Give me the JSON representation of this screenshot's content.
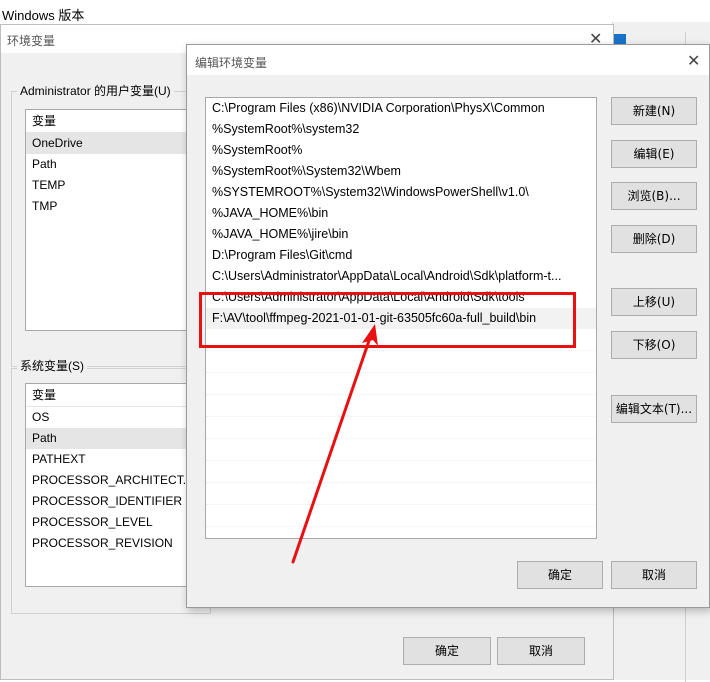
{
  "background_window": {
    "title": "Windows 版本"
  },
  "env_dialog": {
    "title": "环境变量",
    "user_vars": {
      "label": "Administrator 的用户变量(U)",
      "header": "变量",
      "items": [
        "OneDrive",
        "Path",
        "TEMP",
        "TMP"
      ],
      "selected_index": 0
    },
    "system_vars": {
      "label": "系统变量(S)",
      "header": "变量",
      "items": [
        "OS",
        "Path",
        "PATHEXT",
        "PROCESSOR_ARCHITECT...",
        "PROCESSOR_IDENTIFIER",
        "PROCESSOR_LEVEL",
        "PROCESSOR_REVISION"
      ],
      "selected_index": 1
    },
    "ok_label": "确定",
    "cancel_label": "取消"
  },
  "edit_dialog": {
    "title": "编辑环境变量",
    "paths": [
      "C:\\Program Files (x86)\\NVIDIA Corporation\\PhysX\\Common",
      "%SystemRoot%\\system32",
      "%SystemRoot%",
      "%SystemRoot%\\System32\\Wbem",
      "%SYSTEMROOT%\\System32\\WindowsPowerShell\\v1.0\\",
      "%JAVA_HOME%\\bin",
      "%JAVA_HOME%\\jire\\bin",
      "D:\\Program Files\\Git\\cmd",
      "C:\\Users\\Administrator\\AppData\\Local\\Android\\Sdk\\platform-t...",
      "C:\\Users\\Administrator\\AppData\\Local\\Android\\Sdk\\tools",
      "F:\\AV\\tool\\ffmpeg-2021-01-01-git-63505fc60a-full_build\\bin"
    ],
    "selected_index": 10,
    "buttons": {
      "new": "新建(N)",
      "edit": "编辑(E)",
      "browse": "浏览(B)...",
      "delete": "删除(D)",
      "move_up": "上移(U)",
      "move_down": "下移(O)",
      "edit_text": "编辑文本(T)..."
    },
    "ok_label": "确定",
    "cancel_label": "取消"
  },
  "annotation": {
    "color": "#e81010"
  }
}
